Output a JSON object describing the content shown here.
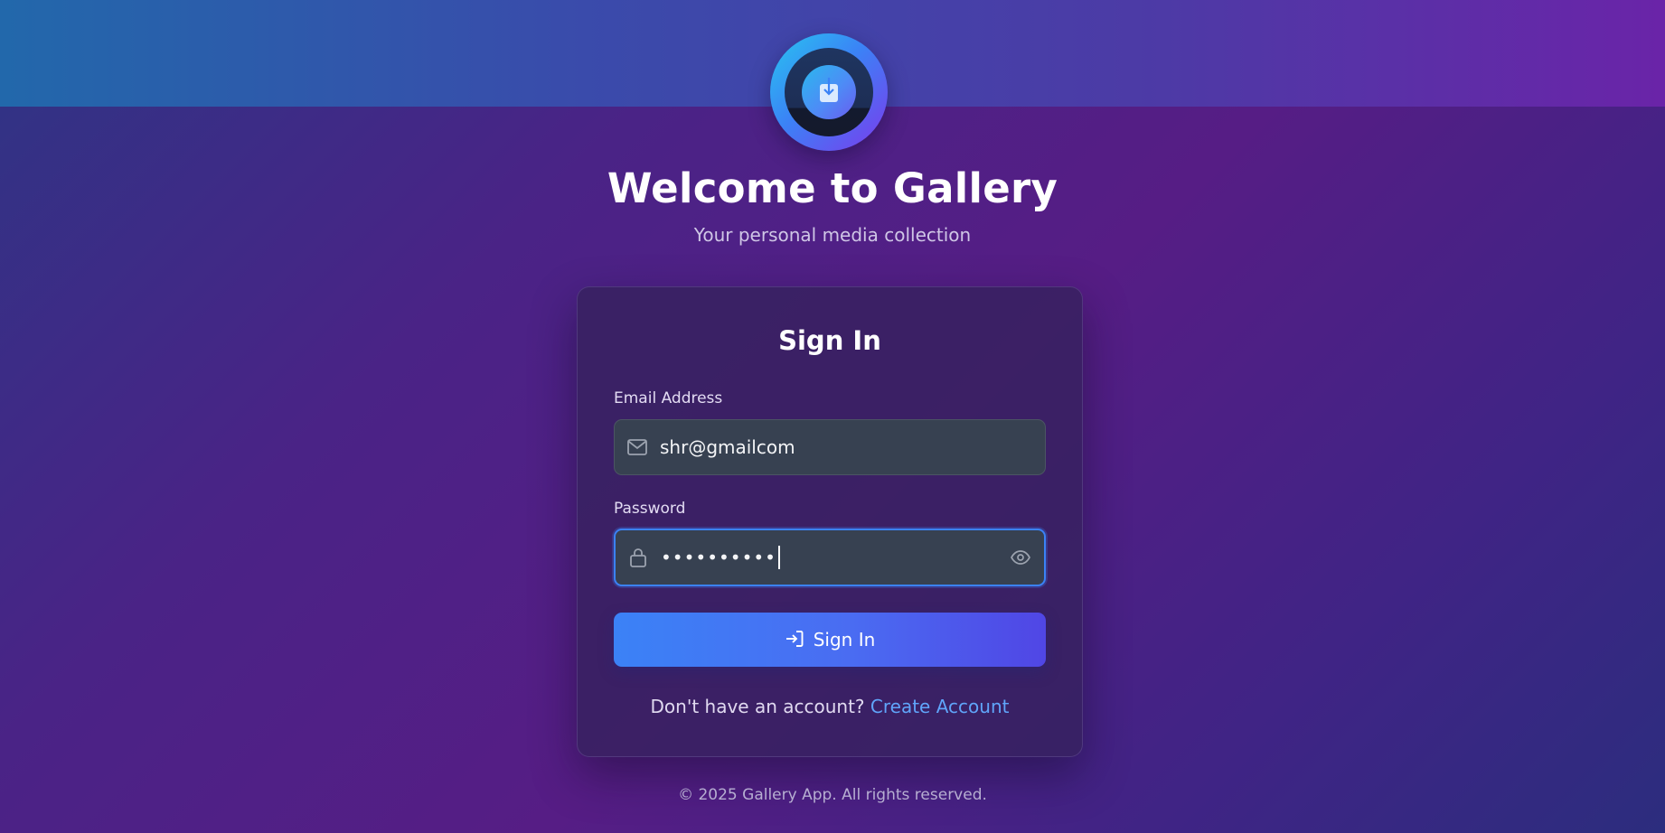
{
  "header": {
    "logo_icon": "download-box-icon",
    "title": "Welcome to Gallery",
    "subtitle": "Your personal media collection"
  },
  "signin_card": {
    "title": "Sign In",
    "email": {
      "label": "Email Address",
      "value": "shr@gmailcom",
      "icon": "mail-icon"
    },
    "password": {
      "label": "Password",
      "masked_value": "••••••••••",
      "icon": "lock-icon",
      "toggle_icon": "eye-icon",
      "focused": true
    },
    "submit": {
      "label": "Sign In",
      "icon": "login-arrow-icon"
    },
    "signup": {
      "prompt": "Don't have an account?",
      "link_label": "Create Account"
    }
  },
  "footer": {
    "text": "© 2025 Gallery App. All rights reserved."
  },
  "colors": {
    "accent": "#3b82f6",
    "accent_end": "#5046e5",
    "link": "#60a5fa",
    "input_bg": "#374151"
  }
}
